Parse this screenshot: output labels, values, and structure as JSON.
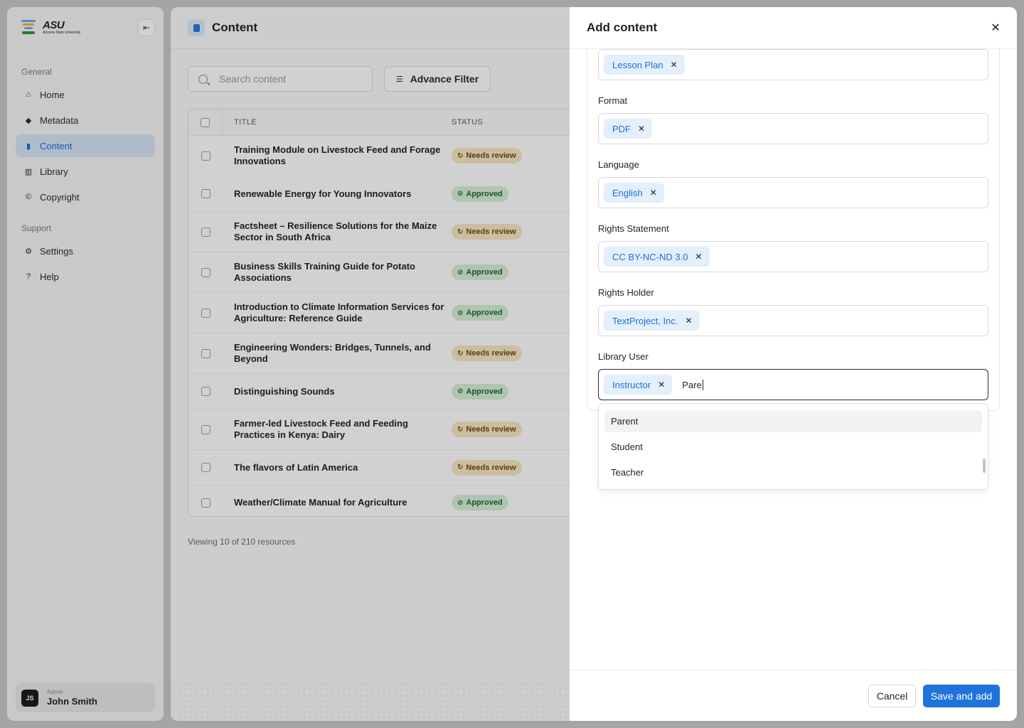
{
  "sidebar": {
    "logo_text": "ASU",
    "logo_subtext": "Arizona State University",
    "sections": {
      "general": "General",
      "support": "Support"
    },
    "items": [
      {
        "label": "Home",
        "icon": "home-icon"
      },
      {
        "label": "Metadata",
        "icon": "tag-icon"
      },
      {
        "label": "Content",
        "icon": "file-icon",
        "active": true
      },
      {
        "label": "Library",
        "icon": "book-icon"
      },
      {
        "label": "Copyright",
        "icon": "copyright-icon"
      },
      {
        "label": "Settings",
        "icon": "gear-icon"
      },
      {
        "label": "Help",
        "icon": "help-icon"
      }
    ],
    "user": {
      "initials": "JS",
      "role": "Admin",
      "name": "John Smith"
    }
  },
  "main": {
    "title": "Content",
    "search_placeholder": "Search content",
    "filter_label": "Advance Filter",
    "columns": {
      "title": "TITLE",
      "status": "STATUS"
    },
    "rows": [
      {
        "title": "Training Module on Livestock Feed and Forage Innovations",
        "status": "Needs review"
      },
      {
        "title": "Renewable Energy for Young Innovators",
        "status": "Approved"
      },
      {
        "title": "Factsheet – Resilience Solutions for the Maize Sector in South Africa",
        "status": "Needs review"
      },
      {
        "title": "Business Skills Training Guide for Potato Associations",
        "status": "Approved"
      },
      {
        "title": "Introduction to Climate Information Services for Agriculture: Reference Guide",
        "status": "Approved"
      },
      {
        "title": "Engineering Wonders: Bridges, Tunnels, and Beyond",
        "status": "Needs review"
      },
      {
        "title": "Distinguishing Sounds",
        "status": "Approved"
      },
      {
        "title": "Farmer-led Livestock Feed and Feeding Practices in Kenya: Dairy",
        "status": "Needs review"
      },
      {
        "title": "The flavors of Latin America",
        "status": "Needs review"
      },
      {
        "title": "Weather/Climate Manual for Agriculture",
        "status": "Approved"
      }
    ],
    "footer": "Viewing 10 of 210 resources"
  },
  "drawer": {
    "title": "Add content",
    "fields": [
      {
        "label": "",
        "chips": [
          "Lesson Plan"
        ]
      },
      {
        "label": "Format",
        "chips": [
          "PDF"
        ]
      },
      {
        "label": "Language",
        "chips": [
          "English"
        ]
      },
      {
        "label": "Rights Statement",
        "chips": [
          "CC BY-NC-ND 3.0"
        ]
      },
      {
        "label": "Rights Holder",
        "chips": [
          "TextProject, Inc."
        ]
      },
      {
        "label": "Library User",
        "chips": [
          "Instructor"
        ],
        "typed": "Pare"
      }
    ],
    "dropdown_options": [
      "Parent",
      "Student",
      "Teacher"
    ],
    "cancel_label": "Cancel",
    "save_label": "Save and add"
  },
  "colors": {
    "accent": "#1f74dc",
    "chip_bg": "#e4effc",
    "review_bg": "#f7e7c4",
    "approved_bg": "#d7f0d9"
  }
}
